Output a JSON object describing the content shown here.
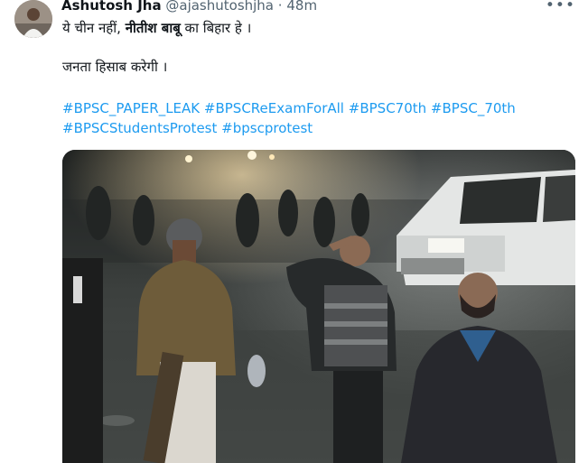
{
  "tweet": {
    "author_name": "Ashutosh Jha",
    "author_handle": "@ajashutoshjha",
    "separator": "·",
    "time": "48m",
    "more_icon": "more-icon",
    "text_line1_prefix": "ये चीन नहीं, ",
    "text_line1_bold": "नीतीश बाबू",
    "text_line1_suffix": " का बिहार हे ।",
    "text_line2": "जनता हिसाब करेगी ।",
    "hashtags": [
      "#BPSC_PAPER_LEAK",
      "#BPSCReExamForAll",
      "#BPSC70th",
      "#BPSC_70th",
      "#BPSCStudentsProtest",
      "#bpscprotest"
    ]
  },
  "colors": {
    "link": "#1d9bf0",
    "text": "#0f1419",
    "muted": "#536471"
  }
}
